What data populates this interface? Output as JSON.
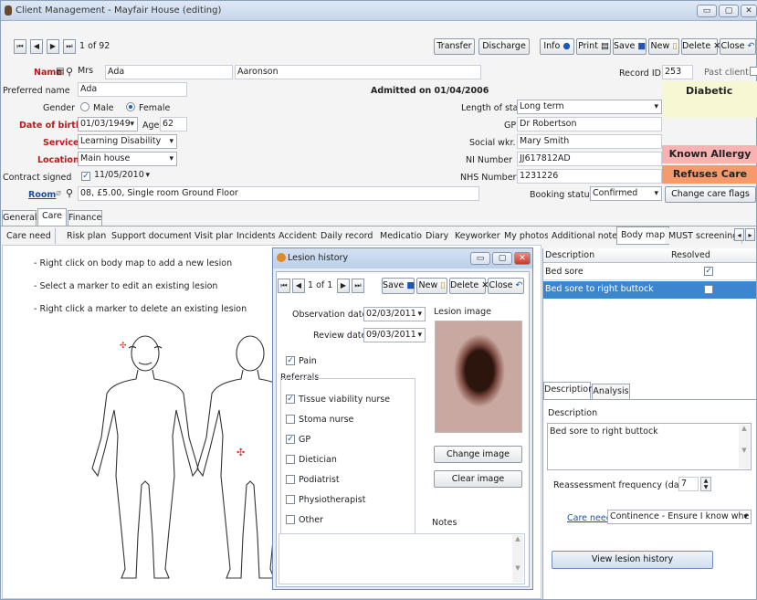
{
  "window": {
    "title": "Client Management - Mayfair House (editing)",
    "min": "▭",
    "max": "▢",
    "close": "✕"
  },
  "record_nav": {
    "first": "⏮",
    "prev": "◀",
    "next": "▶",
    "last": "⏭",
    "position": "1 of 92"
  },
  "toolbar": {
    "transfer": "Transfer",
    "discharge": "Discharge",
    "info": "Info",
    "print": "Print",
    "save": "Save",
    "new": "New",
    "delete": "Delete",
    "close": "Close"
  },
  "client": {
    "name_label": "Name",
    "title": "Mrs",
    "first_name": "Ada",
    "last_name": "Aaronson",
    "record_id_label": "Record ID",
    "record_id": "253",
    "past_client_label": "Past client",
    "preferred_name_label": "Preferred name",
    "preferred_name": "Ada",
    "admitted": "Admitted on 01/04/2006",
    "gender_label": "Gender",
    "male": "Male",
    "female": "Female",
    "dob_label": "Date of birth",
    "dob": "01/03/1949",
    "age_label": "Age",
    "age": "62",
    "service_label": "Service",
    "service": "Learning Disability",
    "location_label": "Location",
    "location": "Main house",
    "contract_label": "Contract signed",
    "contract_date": "11/05/2010",
    "room_label": "Room",
    "room": "08, £5.00, Single room Ground Floor",
    "stay_label": "Length of stay",
    "stay": "Long term",
    "gp_label": "GP",
    "gp": "Dr Robertson",
    "social_label": "Social wkr.",
    "social": "Mary Smith",
    "ni_label": "NI Number",
    "ni": "JJ617812AD",
    "nhs_label": "NHS Number",
    "nhs": "1231226",
    "booking_label": "Booking status",
    "booking": "Confirmed"
  },
  "flags": {
    "diabetic": "Diabetic",
    "allergy": "Known Allergy",
    "refuses": "Refuses Care",
    "change": "Change care flags"
  },
  "main_tabs": [
    "General",
    "Care",
    "Finance"
  ],
  "care_tabs": [
    "Care need",
    "Risk plan",
    "Support documents",
    "Visit plan",
    "Incidents",
    "Accidents",
    "Daily record",
    "Medication",
    "Diary",
    "Keyworker",
    "My photos",
    "Additional notes",
    "Body map",
    "MUST screening"
  ],
  "instructions": [
    "- Right click on body map to add a new lesion",
    "- Select a marker to edit an existing lesion",
    "- Right click a marker to delete an existing lesion"
  ],
  "lesion_dialog": {
    "title": "Lesion history",
    "position": "1 of 1",
    "save": "Save",
    "new": "New",
    "delete": "Delete",
    "close": "Close",
    "obs_label": "Observation date",
    "obs_date": "02/03/2011",
    "review_label": "Review date",
    "review_date": "09/03/2011",
    "pain": "Pain",
    "referrals_label": "Referrals",
    "lesion_image_label": "Lesion image",
    "referrals": [
      "Tissue viability nurse",
      "Stoma nurse",
      "GP",
      "Dietician",
      "Podiatrist",
      "Physiotherapist",
      "Other"
    ],
    "referrals_checked": [
      true,
      false,
      true,
      false,
      false,
      false,
      false
    ],
    "change_image": "Change image",
    "clear_image": "Clear image",
    "notes_label": "Notes"
  },
  "lesion_table": {
    "headers": [
      "Description",
      "Resolved"
    ],
    "rows": [
      {
        "description": "Bed sore",
        "resolved": true
      },
      {
        "description": "Bed sore to right buttock",
        "resolved": false
      }
    ]
  },
  "detail": {
    "tabs": [
      "Description",
      "Analysis"
    ],
    "desc_label": "Description",
    "desc_value": "Bed sore to right buttock",
    "reassess_label": "Reassessment frequency (days)",
    "reassess_value": "7",
    "care_need_label": "Care need",
    "care_need_value": "Continence - Ensure I know whe",
    "view_history": "View lesion history"
  },
  "colors": {
    "flag_yellow": "#f7f7d4",
    "flag_pink": "#f8b2b2",
    "flag_orange": "#f69a6c",
    "select_blue": "#3c86cf",
    "label_red": "#c0171c"
  }
}
